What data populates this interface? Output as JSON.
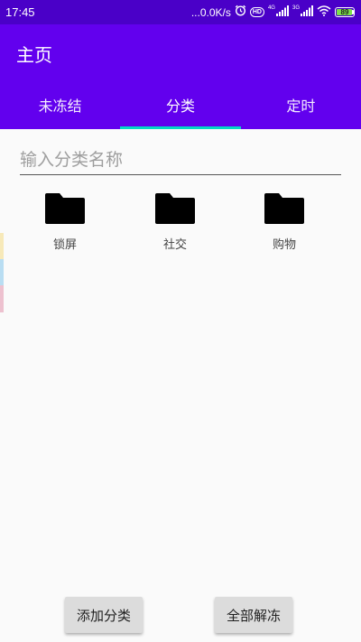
{
  "status_bar": {
    "time": "17:45",
    "speed": "...0.0K/s",
    "hd": "HD",
    "net1": "4G",
    "net2": "3G",
    "battery": "89",
    "icons": [
      "alarm-icon",
      "signal-icon",
      "wifi-icon",
      "battery-icon"
    ]
  },
  "app_bar": {
    "title": "主页"
  },
  "tabs": [
    {
      "label": "未冻结",
      "active": false
    },
    {
      "label": "分类",
      "active": true
    },
    {
      "label": "定时",
      "active": false
    }
  ],
  "search": {
    "placeholder": "输入分类名称",
    "value": ""
  },
  "categories": [
    {
      "label": "锁屏",
      "icon": "folder-icon"
    },
    {
      "label": "社交",
      "icon": "folder-icon"
    },
    {
      "label": "购物",
      "icon": "folder-icon"
    }
  ],
  "buttons": {
    "add_category": "添加分类",
    "unfreeze_all": "全部解冻"
  },
  "colors": {
    "status_bar": "#4A00C8",
    "primary": "#6200EE",
    "accent": "#03DAC5",
    "background": "#FAFAFA",
    "button": "#DCDCDC",
    "edge_strips": [
      "#F7E9B9",
      "#B9DDF2",
      "#EDC1CF"
    ]
  }
}
